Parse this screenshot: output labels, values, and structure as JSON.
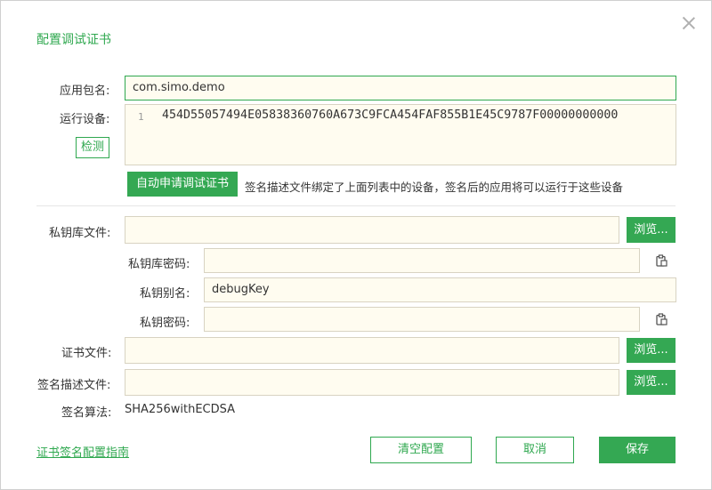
{
  "dialog": {
    "title": "配置调试证书",
    "close_icon": "close-icon"
  },
  "form": {
    "package_label": "应用包名:",
    "package_value": "com.simo.demo",
    "device_label": "运行设备:",
    "device_line_number": "1",
    "device_value": "454D55057494E05838360760A673C9FCA454FAF855B1E45C9787F00000000000",
    "detect_button": "检测",
    "auto_apply_button": "自动申请调试证书",
    "note": "签名描述文件绑定了上面列表中的设备，签名后的应用将可以运行于这些设备",
    "keystore_label": "私钥库文件:",
    "keystore_value": "",
    "browse_label": "浏览...",
    "keystore_password_label": "私钥库密码:",
    "keystore_password_value": "",
    "alias_label": "私钥别名:",
    "alias_value": "debugKey",
    "key_password_label": "私钥密码:",
    "key_password_value": "",
    "cert_label": "证书文件:",
    "cert_value": "",
    "profile_label": "签名描述文件:",
    "profile_value": "",
    "algorithm_label": "签名算法:",
    "algorithm_value": "SHA256withECDSA"
  },
  "footer": {
    "guide_link": "证书签名配置指南",
    "clear_button": "清空配置",
    "cancel_button": "取消",
    "save_button": "保存"
  },
  "colors": {
    "accent": "#34a853",
    "field_bg": "#fffcf0"
  }
}
